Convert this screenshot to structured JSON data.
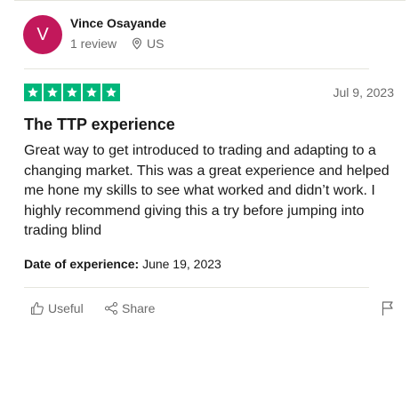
{
  "reviewer": {
    "initial": "V",
    "name": "Vince Osayande",
    "review_count": "1 review",
    "country": "US",
    "avatar_color": "#c2185b"
  },
  "rating": {
    "stars": 5,
    "max": 5,
    "star_color": "#00b67a"
  },
  "review": {
    "date": "Jul 9, 2023",
    "title": "The TTP experience",
    "body": "Great way to get introduced to trading and adapting to a changing market. This was a great experience and helped me hone my skills to see what worked and didn’t work. I highly recommend giving this a try before jumping into trading blind",
    "experience_label": "Date of experience:",
    "experience_date": "June 19, 2023"
  },
  "actions": {
    "useful_label": "Useful",
    "share_label": "Share",
    "useful_icon": "thumbs-up-icon",
    "share_icon": "share-icon",
    "flag_icon": "flag-icon"
  }
}
